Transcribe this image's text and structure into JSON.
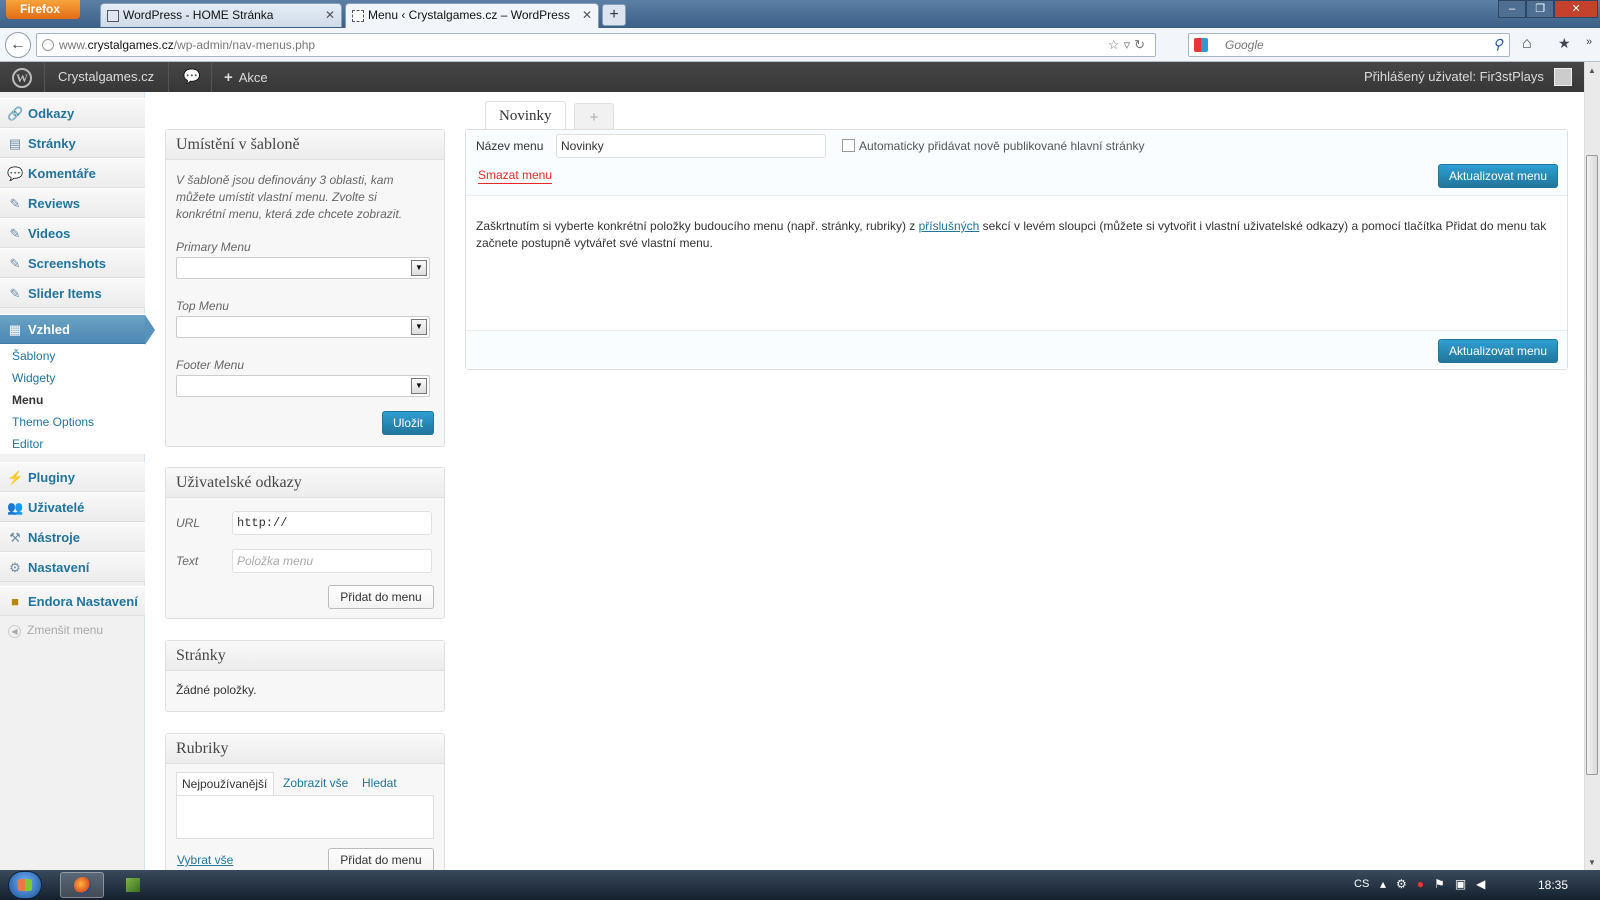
{
  "browser": {
    "firefox_button": "Firefox",
    "tabs": [
      {
        "title": "WordPress - HOME Stránka"
      },
      {
        "title": "Menu ‹ Crystalgames.cz – WordPress"
      }
    ],
    "url_prefix": "www.",
    "url_domain": "crystalgames.cz",
    "url_path": "/wp-admin/nav-menus.php",
    "search_placeholder": "Google"
  },
  "adminbar": {
    "site_name": "Crystalgames.cz",
    "new_label": "Akce",
    "howdy": "Přihlášený uživatel: Fir3stPlays"
  },
  "sidebar": {
    "items": [
      {
        "label": "Odkazy",
        "icon": "link-icon"
      },
      {
        "label": "Stránky",
        "icon": "pages-icon"
      },
      {
        "label": "Komentáře",
        "icon": "comments-icon"
      },
      {
        "label": "Reviews",
        "icon": "pin-icon"
      },
      {
        "label": "Videos",
        "icon": "pin-icon"
      },
      {
        "label": "Screenshots",
        "icon": "pin-icon"
      },
      {
        "label": "Slider Items",
        "icon": "pin-icon"
      },
      {
        "label": "Vzhled",
        "icon": "appearance-icon"
      },
      {
        "label": "Pluginy",
        "icon": "plugins-icon"
      },
      {
        "label": "Uživatelé",
        "icon": "users-icon"
      },
      {
        "label": "Nástroje",
        "icon": "tools-icon"
      },
      {
        "label": "Nastavení",
        "icon": "settings-icon"
      },
      {
        "label": "Endora Nastavení",
        "icon": "endora-icon"
      }
    ],
    "submenu": [
      {
        "label": "Šablony"
      },
      {
        "label": "Widgety"
      },
      {
        "label": "Menu"
      },
      {
        "label": "Theme Options"
      },
      {
        "label": "Editor"
      }
    ],
    "collapse_label": "Zmenšit menu"
  },
  "locations": {
    "title": "Umístění v šabloně",
    "description": "V šabloně jsou definovány 3 oblasti, kam můžete umístit vlastní menu. Zvolte si konkrétní menu, která zde chcete zobrazit.",
    "fields": [
      {
        "label": "Primary Menu",
        "value": ""
      },
      {
        "label": "Top Menu",
        "value": ""
      },
      {
        "label": "Footer Menu",
        "value": ""
      }
    ],
    "save_label": "Uložit"
  },
  "custom_links": {
    "title": "Uživatelské odkazy",
    "url_label": "URL",
    "url_value": "http://",
    "text_label": "Text",
    "text_placeholder": "Položka menu",
    "add_label": "Přidat do menu"
  },
  "pages_box": {
    "title": "Stránky",
    "empty": "Žádné položky."
  },
  "categories_box": {
    "title": "Rubriky",
    "tabs": [
      "Nejpoužívanější",
      "Zobrazit vše",
      "Hledat"
    ],
    "select_all": "Vybrat vše",
    "add_label": "Přidat do menu"
  },
  "menu_editor": {
    "tab_label": "Novinky",
    "add_tab": "+",
    "name_label": "Název menu",
    "name_value": "Novinky",
    "auto_add_label": "Automaticky přidávat nově publikované hlavní stránky",
    "auto_add_checked": false,
    "delete_label": "Smazat menu",
    "update_label": "Aktualizovat menu",
    "instructions_before": "Zaškrtnutím si vyberte konkrétní položky budoucího menu (např. stránky, rubriky) z ",
    "instructions_link": "příslušných",
    "instructions_after": " sekcí v levém sloupci (můžete si vytvořit i vlastní uživatelské odkazy) a pomocí tlačítka Přidat do menu tak začnete postupně vytvářet své vlastní menu."
  },
  "taskbar": {
    "language": "CS",
    "clock": "18:35"
  },
  "colors": {
    "accent": "#21759b",
    "delete": "#e52929",
    "current_menu": "#4a88b4"
  }
}
